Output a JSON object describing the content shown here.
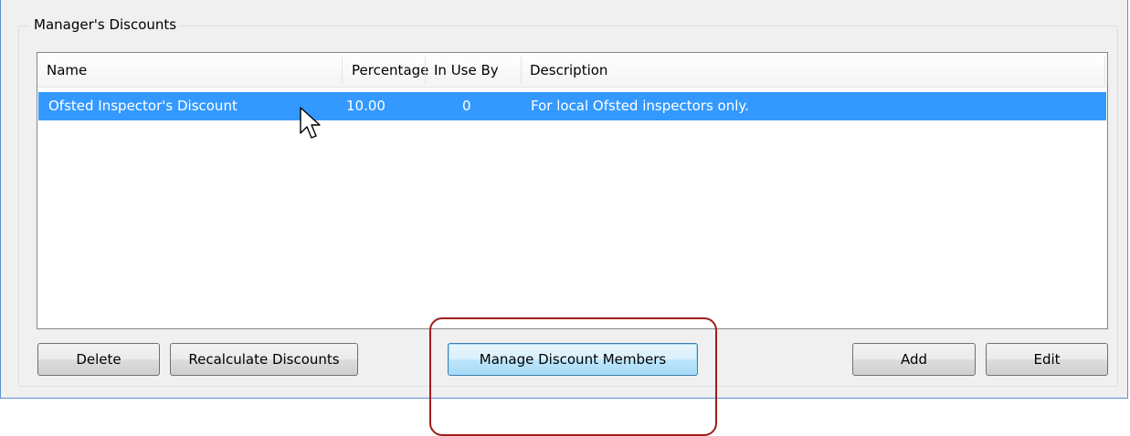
{
  "group": {
    "title": "Manager's Discounts"
  },
  "list": {
    "columns": [
      {
        "label": "Name"
      },
      {
        "label": "Percentage"
      },
      {
        "label": "In Use By"
      },
      {
        "label": "Description"
      }
    ],
    "rows": [
      {
        "name": "Ofsted Inspector's Discount",
        "percentage": "10.00",
        "in_use_by": "0",
        "description": "For local Ofsted inspectors only.",
        "selected": true
      }
    ]
  },
  "buttons": {
    "delete": "Delete",
    "recalculate": "Recalculate Discounts",
    "manage_members": "Manage Discount Members",
    "add": "Add",
    "edit": "Edit"
  },
  "colors": {
    "selection": "#3399ff",
    "highlight_annotation": "#a11c1c",
    "frame_border": "#5a8fd0"
  },
  "icons": {
    "cursor": "mouse-pointer-icon"
  }
}
